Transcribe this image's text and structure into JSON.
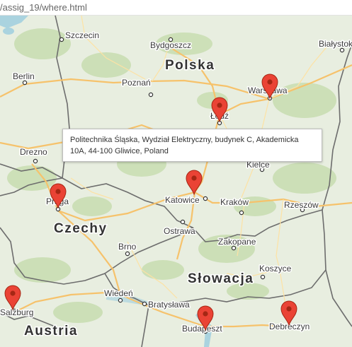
{
  "address_bar": {
    "url": "/assig_19/where.html"
  },
  "info_window": {
    "text": "Politechnika Śląska, Wydział Elektryczny, budynek C, Akademicka 10A, 44-100 Gliwice, Poland"
  },
  "countries": [
    "Polska",
    "Czechy",
    "Słowacja",
    "Austria"
  ],
  "cities": [
    "Szczecin",
    "Bydgoszcz",
    "Białystok",
    "Berlin",
    "Poznań",
    "Warszawa",
    "Łódź",
    "Drezno",
    "Kielce",
    "Praga",
    "Katowice",
    "Kraków",
    "Rzeszów",
    "Ostrawa",
    "Brno",
    "Zakopane",
    "Koszyce",
    "Wiedeń",
    "Bratysława",
    "Budapeszt",
    "Debreczyn",
    "Salzburg"
  ],
  "markers": [
    "Warszawa",
    "Łódź",
    "Gliwice",
    "Praga",
    "Budapeszt",
    "Debreczyn",
    "Salzburg"
  ],
  "colors": {
    "land": "#e8eee0",
    "forest": "#c8ddb0",
    "water": "#aad3df",
    "highway": "#f6c26b",
    "road": "#fde2a4",
    "border": "#6d6d6d",
    "marker": "#ea4335",
    "marker_dark": "#a52714"
  }
}
